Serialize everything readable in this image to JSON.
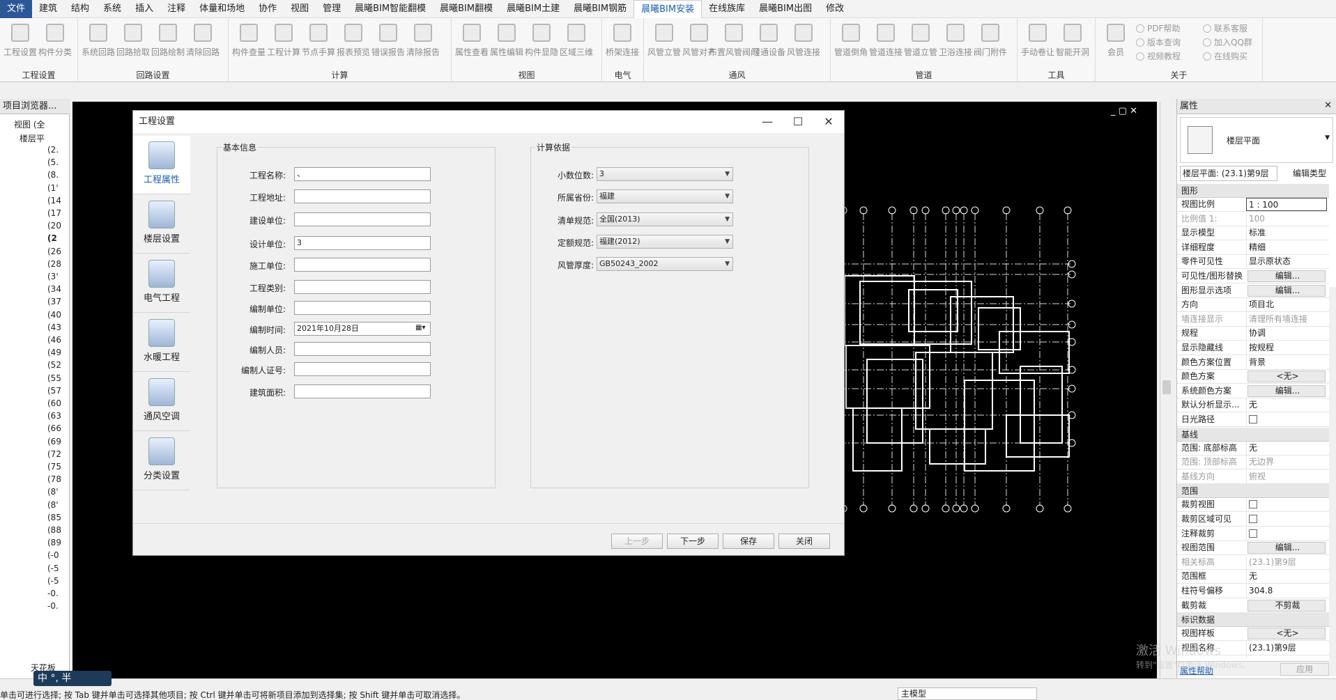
{
  "menu": [
    "文件",
    "建筑",
    "结构",
    "系统",
    "插入",
    "注释",
    "体量和场地",
    "协作",
    "视图",
    "管理",
    "晨曦BIM智能翻模",
    "晨曦BIM翻模",
    "晨曦BIM土建",
    "晨曦BIM钢筋",
    "晨曦BIM安装",
    "在线族库",
    "晨曦BIM出图",
    "修改"
  ],
  "menu_active": "晨曦BIM安装",
  "ribbon": [
    {
      "label": "工程设置",
      "buttons": [
        "工程设置",
        "构件分类"
      ]
    },
    {
      "label": "回路设置",
      "buttons": [
        "系统回路",
        "回路拾取",
        "回路绘制",
        "清除回路"
      ]
    },
    {
      "label": "计算",
      "buttons": [
        "构件查量",
        "工程计算",
        "节点手算",
        "报表预览",
        "错误报告",
        "清除报告"
      ]
    },
    {
      "label": "视图",
      "buttons": [
        "属性查看",
        "属性编辑",
        "构件显隐",
        "区域三维"
      ]
    },
    {
      "label": "电气",
      "buttons": [
        "桥架连接"
      ]
    },
    {
      "label": "通风",
      "buttons": [
        "风管立管",
        "风管对齐",
        "布置风管阀门",
        "暖通设备",
        "风管连接"
      ]
    },
    {
      "label": "管道",
      "buttons": [
        "管道倒角",
        "管道连接",
        "管道立管",
        "卫浴连接",
        "阀门附件"
      ]
    },
    {
      "label": "工具",
      "buttons": [
        "手动卷让",
        "智能开洞"
      ]
    },
    {
      "label": "关于",
      "buttons": [
        "会员"
      ],
      "links": [
        "PDF帮助",
        "版本查询",
        "视频教程",
        "联系客服",
        "加入QQ群",
        "在线购买"
      ]
    }
  ],
  "browser": {
    "title": "项目浏览器...",
    "view_node": "视图 (全",
    "floor_node": "楼层平",
    "items": [
      "(2.",
      "(5.",
      "(8.",
      "(1'",
      "(14",
      "(17",
      "(20",
      "(2",
      "(26",
      "(28",
      "(3'",
      "(34",
      "(37",
      "(40",
      "(43",
      "(46",
      "(49",
      "(52",
      "(55",
      "(57",
      "(60",
      "(63",
      "(66",
      "(69",
      "(72",
      "(75",
      "(78",
      "(8'",
      "(8'",
      "(85",
      "(88",
      "(89",
      "(-0",
      "(-5",
      "(-5",
      "-0.",
      "-0."
    ],
    "ceiling_node": "天花板"
  },
  "dialog": {
    "title": "工程设置",
    "sidebar": [
      "工程属性",
      "楼层设置",
      "电气工程",
      "水暖工程",
      "通风空调",
      "分类设置"
    ],
    "basic": {
      "title": "基本信息",
      "fields": [
        {
          "label": "工程名称:",
          "value": "、"
        },
        {
          "label": "工程地址:",
          "value": ""
        },
        {
          "label": "建设单位:",
          "value": ""
        },
        {
          "label": "设计单位:",
          "value": "3"
        },
        {
          "label": "施工单位:",
          "value": ""
        },
        {
          "label": "工程类别:",
          "value": ""
        },
        {
          "label": "编制单位:",
          "value": ""
        },
        {
          "label": "编制时间:",
          "value": "2021年10月28日"
        },
        {
          "label": "编制人员:",
          "value": ""
        },
        {
          "label": "编制人证号:",
          "value": ""
        },
        {
          "label": "建筑面积:",
          "value": ""
        }
      ]
    },
    "calc": {
      "title": "计算依据",
      "fields": [
        {
          "label": "小数位数:",
          "value": "3"
        },
        {
          "label": "所属省份:",
          "value": "福建"
        },
        {
          "label": "清单规范:",
          "value": "全国(2013)"
        },
        {
          "label": "定额规范:",
          "value": "福建(2012)"
        },
        {
          "label": "风管厚度:",
          "value": "GB50243_2002"
        }
      ]
    },
    "buttons": {
      "prev": "上一步",
      "next": "下一步",
      "save": "保存",
      "close": "关闭"
    }
  },
  "props": {
    "title": "属性",
    "type_name": "楼层平面",
    "selector": "楼层平面: (23.1)第9层",
    "edit_type": "编辑类型",
    "sections": [
      {
        "name": "图形",
        "rows": [
          {
            "k": "视图比例",
            "v": "1 : 100",
            "style": "input"
          },
          {
            "k": "比例值 1:",
            "v": "100",
            "grey": true
          },
          {
            "k": "显示模型",
            "v": "标准"
          },
          {
            "k": "详细程度",
            "v": "精细"
          },
          {
            "k": "零件可见性",
            "v": "显示原状态"
          },
          {
            "k": "可见性/图形替换",
            "v": "编辑...",
            "style": "btn"
          },
          {
            "k": "图形显示选项",
            "v": "编辑...",
            "style": "btn"
          },
          {
            "k": "方向",
            "v": "项目北"
          },
          {
            "k": "墙连接显示",
            "v": "清理所有墙连接",
            "grey": true
          },
          {
            "k": "规程",
            "v": "协调"
          },
          {
            "k": "显示隐藏线",
            "v": "按规程"
          },
          {
            "k": "颜色方案位置",
            "v": "背景"
          },
          {
            "k": "颜色方案",
            "v": "<无>",
            "style": "btn"
          },
          {
            "k": "系统颜色方案",
            "v": "编辑...",
            "style": "btn"
          },
          {
            "k": "默认分析显示...",
            "v": "无"
          },
          {
            "k": "日光路径",
            "v": "",
            "style": "check"
          }
        ]
      },
      {
        "name": "基线",
        "rows": [
          {
            "k": "范围: 底部标高",
            "v": "无"
          },
          {
            "k": "范围: 顶部标高",
            "v": "无边界",
            "grey": true
          },
          {
            "k": "基线方向",
            "v": "俯视",
            "grey": true
          }
        ]
      },
      {
        "name": "范围",
        "rows": [
          {
            "k": "裁剪视图",
            "v": "",
            "style": "check"
          },
          {
            "k": "裁剪区域可见",
            "v": "",
            "style": "check"
          },
          {
            "k": "注释裁剪",
            "v": "",
            "style": "check"
          },
          {
            "k": "视图范围",
            "v": "编辑...",
            "style": "btn"
          },
          {
            "k": "相关标高",
            "v": "(23.1)第9层",
            "grey": true
          },
          {
            "k": "范围框",
            "v": "无"
          },
          {
            "k": "柱符号偏移",
            "v": "304.8"
          },
          {
            "k": "截剪裁",
            "v": "不剪裁",
            "style": "btn"
          }
        ]
      },
      {
        "name": "标识数据",
        "rows": [
          {
            "k": "视图样板",
            "v": "<无>",
            "style": "btn"
          },
          {
            "k": "视图名称",
            "v": "(23.1)第9层"
          },
          {
            "k": "相关性",
            "v": "不相关",
            "grey": true
          },
          {
            "k": "图纸上的标题",
            "v": ""
          }
        ]
      }
    ],
    "help": "属性帮助",
    "apply": "应用"
  },
  "watermark": {
    "line1": "激活 Windows",
    "line2": "转到\"设置\"以激活 Windows。"
  },
  "ime": "中 °, 半",
  "status": {
    "text": "单击可进行选择; 按 Tab 键并单击可选择其他项目; 按 Ctrl 键并单击可将新项目添加到选择集; 按 Shift 键并单击可取消选择。",
    "model": "主模型"
  }
}
